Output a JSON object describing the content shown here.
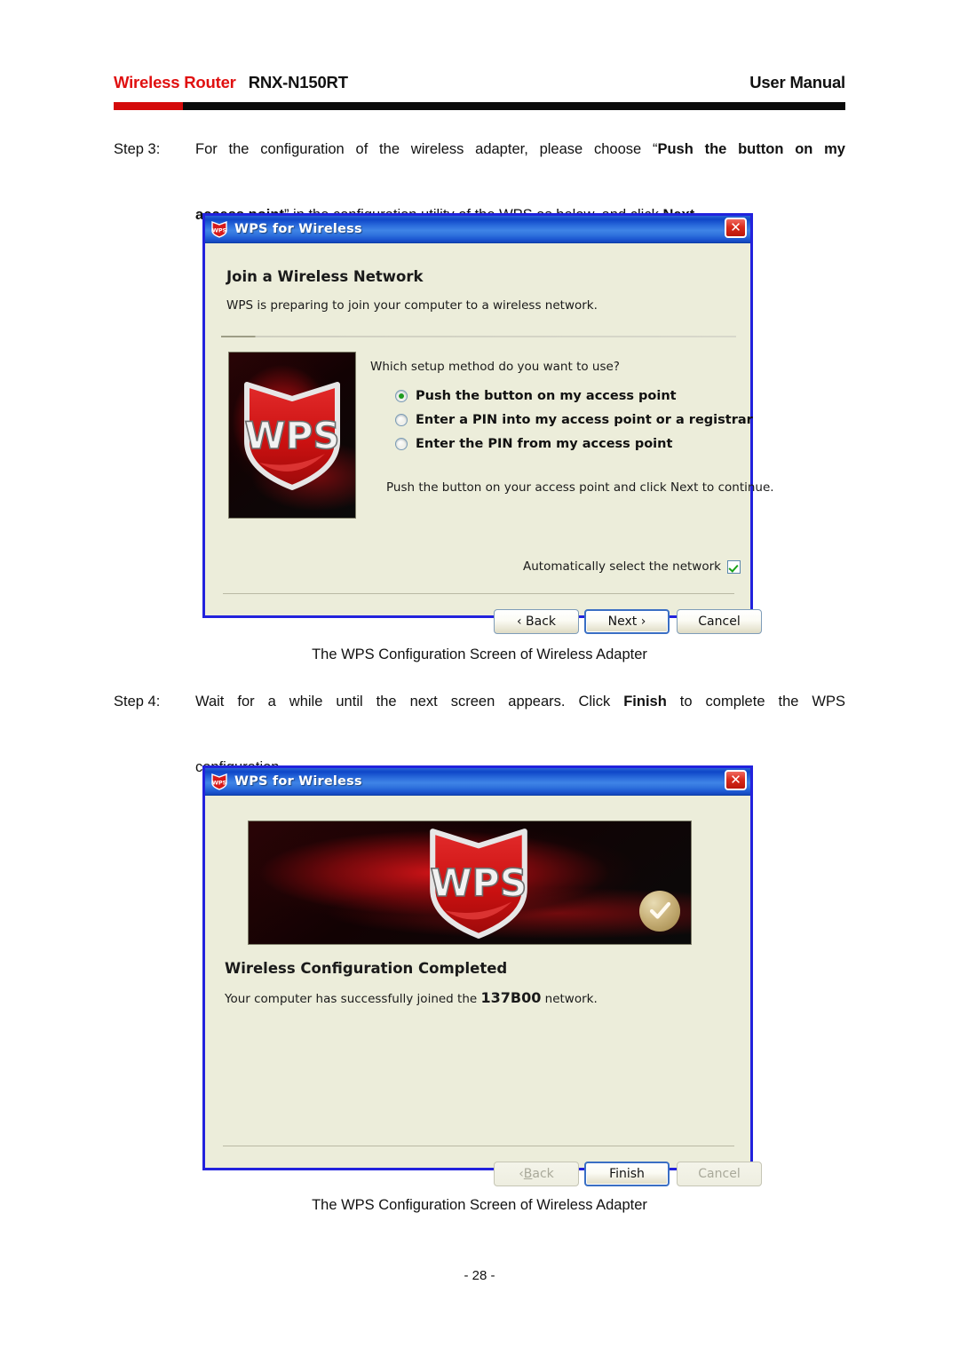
{
  "header": {
    "product_type": "Wireless Router",
    "model": "RNX-N150RT",
    "doc_type": "User Manual"
  },
  "steps": [
    {
      "label": "Step 3:",
      "line1_a": "For the configuration of the wireless adapter, please choose “",
      "line1_b": "Push the button on my",
      "line2_a": "access point",
      "line2_b": "” in the configuration utility of the WPS as below, and click ",
      "line2_c": "Next",
      "line2_d": "."
    },
    {
      "label": "Step 4:",
      "line1_a": "Wait for a while until the next screen appears. Click ",
      "line1_b": "Finish",
      "line1_c": " to complete the WPS",
      "line2": "configuration."
    }
  ],
  "captions": {
    "figure1": "The WPS Configuration Screen of Wireless Adapter",
    "figure2": "The WPS Configuration Screen of Wireless Adapter"
  },
  "page_number": "- 28 -",
  "dialog1": {
    "title": "WPS for Wireless",
    "close_label": "✕",
    "heading": "Join a Wireless Network",
    "subtext": "WPS is preparing to join your computer to a wireless network.",
    "question": "Which setup method do you want to use?",
    "logo_text": "WPS",
    "options": [
      {
        "label": "Push the button on my access point",
        "selected": true
      },
      {
        "label": "Enter a PIN into my access point or a registrar",
        "selected": false
      },
      {
        "label": "Enter the PIN from my access point",
        "selected": false
      }
    ],
    "hint": "Push the button on your access point and click Next to continue.",
    "checkbox": {
      "label": "Automatically select the network",
      "checked": true
    },
    "buttons": {
      "back": "‹ Back",
      "next": "Next ›",
      "cancel": "Cancel"
    }
  },
  "dialog2": {
    "title": "WPS for Wireless",
    "close_label": "✕",
    "logo_text": "WPS",
    "heading": "Wireless Configuration Completed",
    "message_a": "Your computer has successfully joined the ",
    "network_name": "137B00",
    "message_b": " network.",
    "buttons": {
      "back_prefix": "‹ ",
      "back_underline": "B",
      "back_suffix": "ack",
      "finish": "Finish",
      "cancel": "Cancel"
    }
  },
  "colors": {
    "brand_red": "#e01010",
    "rule_black": "#0a0a0a",
    "dialog_border_blue": "#2222dd",
    "dialog_face": "#ecedda",
    "titlebar_blue": "#1b55cf",
    "radio_green": "#1f9b1f"
  }
}
